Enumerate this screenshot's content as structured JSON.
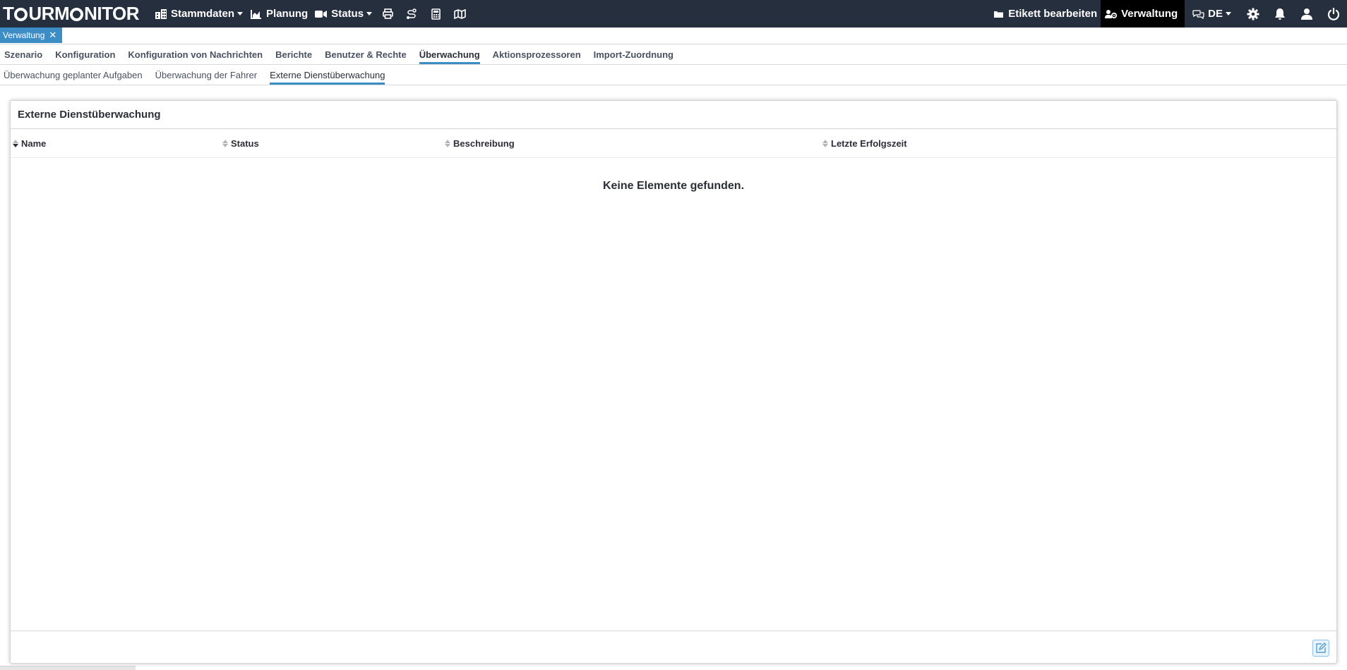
{
  "app": {
    "logo_left": "T",
    "logo_mid": "URM",
    "logo_right": "NITOR"
  },
  "navbar": {
    "stammdaten": "Stammdaten",
    "planung": "Planung",
    "status": "Status",
    "icons": [
      "print-icon",
      "route-icon",
      "calculator-icon",
      "map-icon"
    ],
    "etikett": "Etikett bearbeiten",
    "verwaltung": "Verwaltung",
    "language": "DE",
    "right_icons": [
      "gear-icon",
      "bell-icon",
      "user-icon",
      "power-icon"
    ]
  },
  "app_tab": {
    "label": "Verwaltung",
    "close": "✕"
  },
  "menu1": [
    {
      "label": "Szenario",
      "active": false
    },
    {
      "label": "Konfiguration",
      "active": false
    },
    {
      "label": "Konfiguration von Nachrichten",
      "active": false
    },
    {
      "label": "Berichte",
      "active": false
    },
    {
      "label": "Benutzer & Rechte",
      "active": false
    },
    {
      "label": "Überwachung",
      "active": true
    },
    {
      "label": "Aktionsprozessoren",
      "active": false
    },
    {
      "label": "Import-Zuordnung",
      "active": false
    }
  ],
  "menu2": [
    {
      "label": "Überwachung geplanter Aufgaben",
      "active": false
    },
    {
      "label": "Überwachung der Fahrer",
      "active": false
    },
    {
      "label": "Externe Dienstüberwachung",
      "active": true
    }
  ],
  "panel": {
    "title": "Externe Dienstüberwachung",
    "columns": [
      "Name",
      "Status",
      "Beschreibung",
      "Letzte Erfolgszeit"
    ],
    "empty_message": "Keine Elemente gefunden."
  },
  "colors": {
    "navbar": "#262f3d",
    "accent": "#3c8dc5",
    "active_nav": "#000000"
  }
}
